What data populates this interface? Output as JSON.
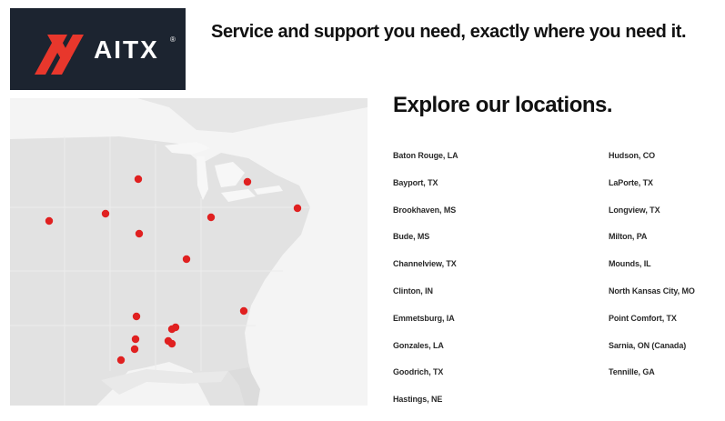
{
  "brand": {
    "name": "AITX",
    "reg_mark": "®",
    "logo_bg": "#1c2430",
    "accent": "#e8372c"
  },
  "header": {
    "tagline": "Service and support you need, exactly where you need it."
  },
  "locations": {
    "heading": "Explore our locations.",
    "left_column": [
      "Baton Rouge, LA",
      "Bayport, TX",
      "Brookhaven, MS",
      "Bude, MS",
      "Channelview, TX",
      "Clinton, IN",
      "Emmetsburg, IA",
      "Gonzales, LA",
      "Goodrich, TX",
      "Hastings, NE"
    ],
    "right_column": [
      "Hudson, CO",
      "LaPorte, TX",
      "Longview, TX",
      "Milton, PA",
      "Mounds, IL",
      "North Kansas City, MO",
      "Point Comfort, TX",
      "Sarnia, ON (Canada)",
      "Tennille, GA"
    ]
  },
  "map": {
    "icon": "us-map-with-location-markers",
    "land_color": "#e3e3e3",
    "water_color": "#f4f4f4",
    "marker_color": "#e02020"
  }
}
